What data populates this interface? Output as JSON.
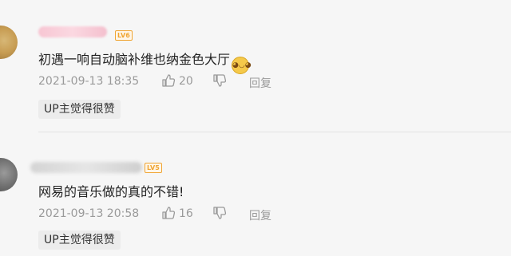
{
  "comments": [
    {
      "level": "LV6",
      "text": "初遇一响自动脑补维也纳金色大厅",
      "emoji": "doge",
      "time": "2021-09-13 18:35",
      "likes": "20",
      "reply_label": "回复",
      "badge": "UP主觉得很赞"
    },
    {
      "level": "LV5",
      "text": "网易的音乐做的真的不错!",
      "time": "2021-09-13 20:58",
      "likes": "16",
      "reply_label": "回复",
      "badge": "UP主觉得很赞"
    }
  ],
  "icons": {
    "like": "thumbs-up-icon",
    "dislike": "thumbs-down-icon"
  },
  "colors": {
    "level_badge": "#f0a533",
    "meta_text": "#9a9a9a",
    "badge_bg": "#ececec"
  }
}
